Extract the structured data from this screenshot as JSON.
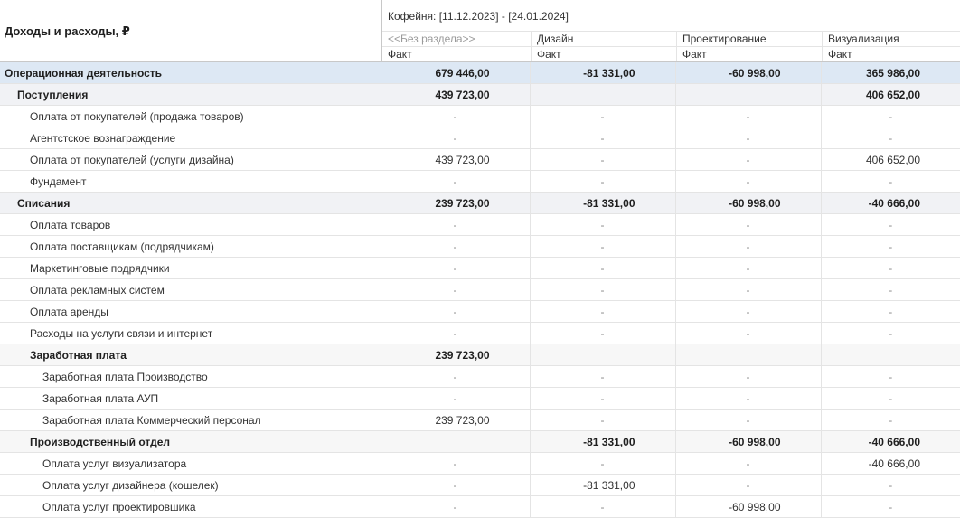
{
  "header": {
    "title": "Доходы и расходы, ₽",
    "period": "Кофейня: [11.12.2023] - [24.01.2024]",
    "columns": [
      "<<Без раздела>>",
      "Дизайн",
      "Проектирование",
      "Визуализация"
    ],
    "subheaders": [
      "Факт",
      "Факт",
      "Факт",
      "Факт"
    ]
  },
  "rows": [
    {
      "label": "Операционная деятельность",
      "level": 0,
      "group": true,
      "values": [
        "679 446,00",
        "-81 331,00",
        "-60 998,00",
        "365 986,00"
      ]
    },
    {
      "label": "Поступления",
      "level": 1,
      "group": true,
      "values": [
        "439 723,00",
        "",
        "",
        "406 652,00"
      ]
    },
    {
      "label": "Оплата от покупателей (продажа товаров)",
      "level": 2,
      "group": false,
      "values": [
        "-",
        "-",
        "-",
        "-"
      ]
    },
    {
      "label": "Агентстское вознаграждение",
      "level": 2,
      "group": false,
      "values": [
        "-",
        "-",
        "-",
        "-"
      ]
    },
    {
      "label": "Оплата от покупателей (услуги дизайна)",
      "level": 2,
      "group": false,
      "values": [
        "439 723,00",
        "-",
        "-",
        "406 652,00"
      ]
    },
    {
      "label": "Фундамент",
      "level": 2,
      "group": false,
      "values": [
        "-",
        "-",
        "-",
        "-"
      ]
    },
    {
      "label": "Списания",
      "level": 1,
      "group": true,
      "values": [
        "239 723,00",
        "-81 331,00",
        "-60 998,00",
        "-40 666,00"
      ]
    },
    {
      "label": "Оплата товаров",
      "level": 2,
      "group": false,
      "values": [
        "-",
        "-",
        "-",
        "-"
      ]
    },
    {
      "label": "Оплата поставщикам (подрядчикам)",
      "level": 2,
      "group": false,
      "values": [
        "-",
        "-",
        "-",
        "-"
      ]
    },
    {
      "label": "Маркетинговые подрядчики",
      "level": 2,
      "group": false,
      "values": [
        "-",
        "-",
        "-",
        "-"
      ]
    },
    {
      "label": "Оплата рекламных систем",
      "level": 2,
      "group": false,
      "values": [
        "-",
        "-",
        "-",
        "-"
      ]
    },
    {
      "label": "Оплата аренды",
      "level": 2,
      "group": false,
      "values": [
        "-",
        "-",
        "-",
        "-"
      ]
    },
    {
      "label": "Расходы на  услуги связи и интернет",
      "level": 2,
      "group": false,
      "values": [
        "-",
        "-",
        "-",
        "-"
      ]
    },
    {
      "label": "Заработная плата",
      "level": 2,
      "group": true,
      "values": [
        "239 723,00",
        "",
        "",
        ""
      ]
    },
    {
      "label": "Заработная плата Производство",
      "level": 3,
      "group": false,
      "values": [
        "-",
        "-",
        "-",
        "-"
      ]
    },
    {
      "label": "Заработная плата АУП",
      "level": 3,
      "group": false,
      "values": [
        "-",
        "-",
        "-",
        "-"
      ]
    },
    {
      "label": "Заработная плата Коммерческий персонал",
      "level": 3,
      "group": false,
      "values": [
        "239 723,00",
        "-",
        "-",
        "-"
      ]
    },
    {
      "label": "Производственный отдел",
      "level": 2,
      "group": true,
      "values": [
        "",
        "-81 331,00",
        "-60 998,00",
        "-40 666,00"
      ]
    },
    {
      "label": "Оплата услуг визуализатора",
      "level": 3,
      "group": false,
      "values": [
        "-",
        "-",
        "-",
        "-40 666,00"
      ]
    },
    {
      "label": "Оплата услуг дизайнера (кошелек)",
      "level": 3,
      "group": false,
      "values": [
        "-",
        "-81 331,00",
        "-",
        "-"
      ]
    },
    {
      "label": "Оплата услуг проектировшика",
      "level": 3,
      "group": false,
      "values": [
        "-",
        "-",
        "-60 998,00",
        "-"
      ]
    }
  ]
}
